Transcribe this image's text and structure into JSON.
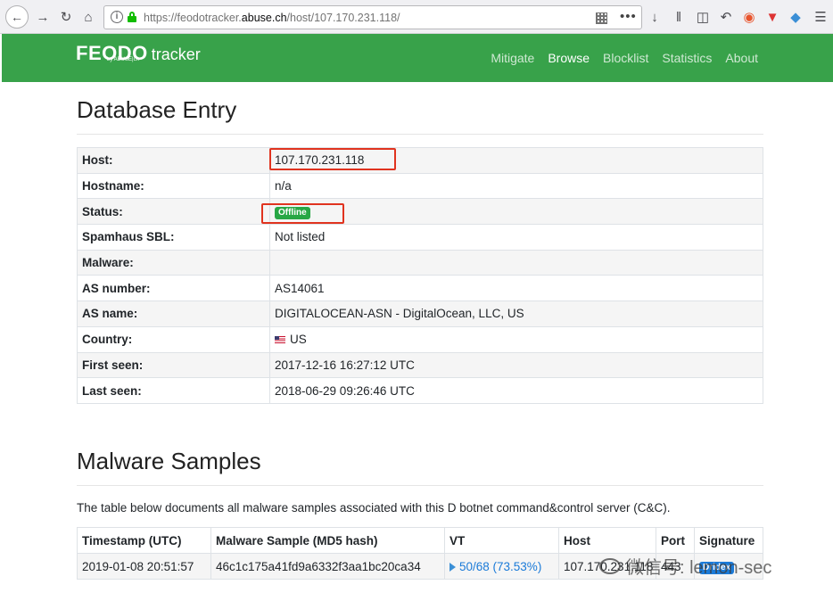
{
  "browser": {
    "url_prefix": "https://feodotracker.",
    "url_domain": "abuse.ch",
    "url_path": "/host/107.170.231.118/"
  },
  "navbar": {
    "brand_main": "FEODO",
    "brand_sub": "tracker",
    "brand_by": "by ABUSE|ch",
    "links": [
      "Mitigate",
      "Browse",
      "Blocklist",
      "Statistics",
      "About"
    ],
    "active": "Browse"
  },
  "database": {
    "heading": "Database Entry",
    "rows": [
      {
        "key": "Host:",
        "value": "107.170.231.118"
      },
      {
        "key": "Hostname:",
        "value": "n/a"
      },
      {
        "key": "Status:",
        "value": "Offline"
      },
      {
        "key": "Spamhaus SBL:",
        "value": "Not listed"
      },
      {
        "key": "Malware:",
        "value": ""
      },
      {
        "key": "AS number:",
        "value": "AS14061"
      },
      {
        "key": "AS name:",
        "value": "DIGITALOCEAN-ASN - DigitalOcean, LLC, US"
      },
      {
        "key": "Country:",
        "value": "US"
      },
      {
        "key": "First seen:",
        "value": "2017-12-16 16:27:12 UTC"
      },
      {
        "key": "Last seen:",
        "value": "2018-06-29 09:26:46 UTC"
      }
    ]
  },
  "samples": {
    "heading": "Malware Samples",
    "description": "The table below documents all malware samples associated with this D botnet command&control server (C&C).",
    "columns": [
      "Timestamp (UTC)",
      "Malware Sample (MD5 hash)",
      "VT",
      "Host",
      "Port",
      "Signature"
    ],
    "rows": [
      {
        "timestamp": "2019-01-08 20:51:57",
        "md5": "46c1c175a41fd9a6332f3aa1bc20ca34",
        "vt": "50/68 (73.53%)",
        "host": "107.170.231.118",
        "port": "443",
        "signature": "Dridex"
      }
    ]
  },
  "watermark": "微信号: lemon-sec",
  "colors": {
    "navbar": "#38a24a",
    "offline_badge": "#28a745",
    "highlight": "#e0331f",
    "link": "#1a7ad8"
  }
}
